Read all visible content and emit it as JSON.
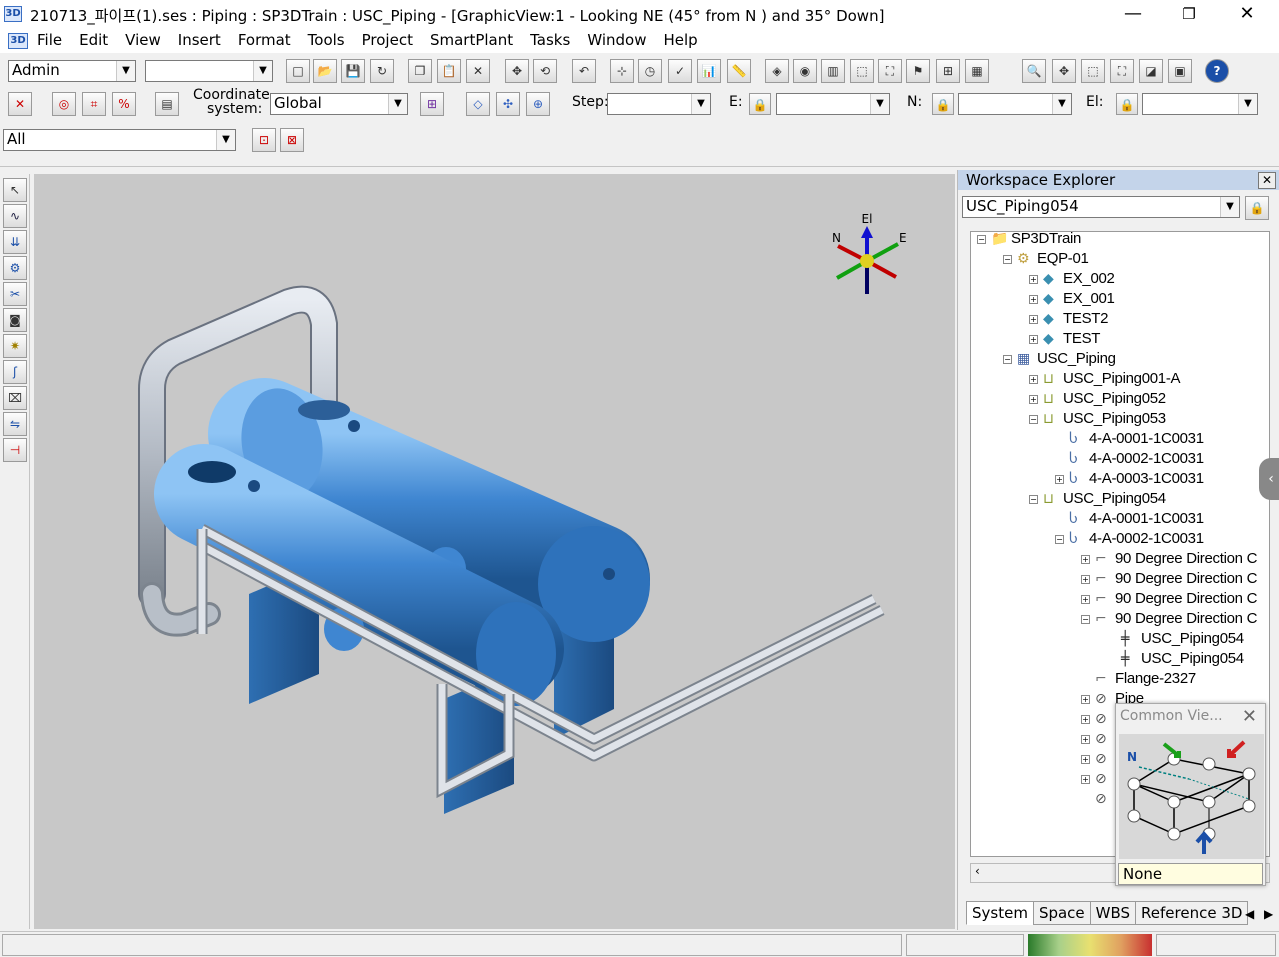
{
  "window": {
    "title": "210713_파이프(1).ses : Piping : SP3DTrain : USC_Piping - [GraphicView:1 - Looking NE (45° from N ) and 35° Down]",
    "app_icon": "3D",
    "minimize": "—",
    "restore": "❐",
    "close": "✕"
  },
  "menu": {
    "app_icon": "3D",
    "items": [
      "File",
      "Edit",
      "View",
      "Insert",
      "Format",
      "Tools",
      "Project",
      "SmartPlant",
      "Tasks",
      "Window",
      "Help"
    ]
  },
  "toolbar1": {
    "role_combo": "Admin",
    "second_combo": ""
  },
  "toolbar2": {
    "coordinate_label_1": "Coordinate",
    "coordinate_label_2": "system:",
    "coordinate_value": "Global",
    "step_label": "Step:",
    "step_value": "",
    "e_label": "E:",
    "e_value": "",
    "n_label": "N:",
    "n_value": "",
    "el_label": "El:",
    "el_value": ""
  },
  "toolbar3": {
    "filter_combo": "All"
  },
  "compass": {
    "n": "N",
    "e": "E",
    "el": "El"
  },
  "workspace_explorer": {
    "title": "Workspace Explorer",
    "filter_value": "USC_Piping054",
    "tree": [
      {
        "label": "SP3DTrain",
        "level": 0,
        "toggle": "-",
        "icon": "folder"
      },
      {
        "label": "EQP-01",
        "level": 1,
        "toggle": "-",
        "icon": "equipment-system"
      },
      {
        "label": "EX_002",
        "level": 2,
        "toggle": "+",
        "icon": "equipment"
      },
      {
        "label": "EX_001",
        "level": 2,
        "toggle": "+",
        "icon": "equipment"
      },
      {
        "label": "TEST2",
        "level": 2,
        "toggle": "+",
        "icon": "equipment"
      },
      {
        "label": "TEST",
        "level": 2,
        "toggle": "+",
        "icon": "equipment"
      },
      {
        "label": "USC_Piping",
        "level": 1,
        "toggle": "-",
        "icon": "piping-system"
      },
      {
        "label": "USC_Piping001-A",
        "level": 2,
        "toggle": "+",
        "icon": "pipeline"
      },
      {
        "label": "USC_Piping052",
        "level": 2,
        "toggle": "+",
        "icon": "pipeline"
      },
      {
        "label": "USC_Piping053",
        "level": 2,
        "toggle": "-",
        "icon": "pipeline"
      },
      {
        "label": "4-A-0001-1C0031",
        "level": 3,
        "toggle": "",
        "icon": "pipe-run"
      },
      {
        "label": "4-A-0002-1C0031",
        "level": 3,
        "toggle": "",
        "icon": "pipe-run"
      },
      {
        "label": "4-A-0003-1C0031",
        "level": 3,
        "toggle": "+",
        "icon": "pipe-run"
      },
      {
        "label": "USC_Piping054",
        "level": 2,
        "toggle": "-",
        "icon": "pipeline"
      },
      {
        "label": "4-A-0001-1C0031",
        "level": 3,
        "toggle": "",
        "icon": "pipe-run"
      },
      {
        "label": "4-A-0002-1C0031",
        "level": 3,
        "toggle": "-",
        "icon": "pipe-run"
      },
      {
        "label": "90 Degree Direction C",
        "level": 4,
        "toggle": "+",
        "icon": "elbow"
      },
      {
        "label": "90 Degree Direction C",
        "level": 4,
        "toggle": "+",
        "icon": "elbow"
      },
      {
        "label": "90 Degree Direction C",
        "level": 4,
        "toggle": "+",
        "icon": "elbow"
      },
      {
        "label": "90 Degree Direction C",
        "level": 4,
        "toggle": "-",
        "icon": "elbow"
      },
      {
        "label": "USC_Piping054",
        "level": 5,
        "toggle": "",
        "icon": "connection"
      },
      {
        "label": "USC_Piping054",
        "level": 5,
        "toggle": "",
        "icon": "connection"
      },
      {
        "label": "Flange-2327",
        "level": 4,
        "toggle": "",
        "icon": "flange"
      },
      {
        "label": "Pipe",
        "level": 4,
        "toggle": "+",
        "icon": "pipe"
      },
      {
        "label": "",
        "level": 4,
        "toggle": "+",
        "icon": "pipe"
      },
      {
        "label": "",
        "level": 4,
        "toggle": "+",
        "icon": "pipe"
      },
      {
        "label": "",
        "level": 4,
        "toggle": "+",
        "icon": "pipe"
      },
      {
        "label": "",
        "level": 4,
        "toggle": "+",
        "icon": "pipe"
      },
      {
        "label": "",
        "level": 4,
        "toggle": "",
        "icon": "pipe"
      }
    ],
    "tabs": [
      "System",
      "Space",
      "WBS",
      "Reference 3D"
    ]
  },
  "common_views": {
    "title": "Common Vie...",
    "north_label": "N",
    "selection": "None"
  },
  "colors": {
    "viewport_bg": "#c8c8c8",
    "equipment_blue": "#4a8fd6",
    "pipe_grey": "#b8bfc8",
    "panel_header": "#c4d4ea"
  }
}
